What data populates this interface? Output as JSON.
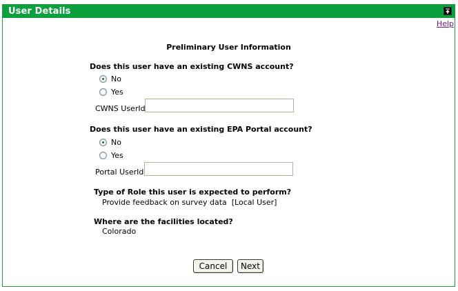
{
  "window": {
    "title": "User Details",
    "help_link": "Help"
  },
  "form": {
    "heading": "Preliminary User Information",
    "cwns": {
      "question": "Does this user have an existing CWNS account?",
      "options": [
        {
          "label": "No",
          "selected": true
        },
        {
          "label": "Yes",
          "selected": false
        }
      ],
      "userid_label": "CWNS UserId",
      "userid_value": ""
    },
    "epa": {
      "question": "Does this user have an existing EPA Portal account?",
      "options": [
        {
          "label": "No",
          "selected": true
        },
        {
          "label": "Yes",
          "selected": false
        }
      ],
      "userid_label": "Portal UserId",
      "userid_value": ""
    },
    "role": {
      "label": "Type of Role this user is expected to perform?",
      "value": "Provide feedback on survey data  [Local User]"
    },
    "facilities": {
      "label": "Where are the facilities located?",
      "value": "Colorado"
    }
  },
  "buttons": {
    "cancel": "Cancel",
    "next": "Next"
  },
  "colors": {
    "titlebar": "#0c9f3d",
    "border": "#1c9a3c",
    "help_link": "#6b1a8b"
  }
}
